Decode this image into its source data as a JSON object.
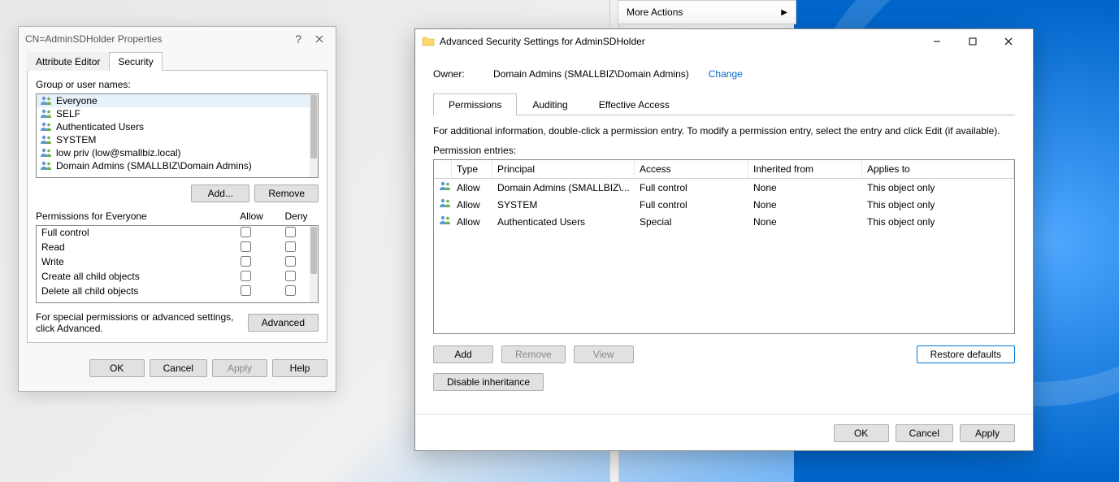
{
  "bgMenu": {
    "moreActions": "More Actions"
  },
  "win1": {
    "title": "CN=AdminSDHolder Properties",
    "tabs": [
      "Attribute Editor",
      "Security"
    ],
    "activeTab": 1,
    "groupLabel": "Group or user names:",
    "principals": [
      "Everyone",
      "SELF",
      "Authenticated Users",
      "SYSTEM",
      "low priv (low@smallbiz.local)",
      "Domain Admins (SMALLBIZ\\Domain Admins)"
    ],
    "addBtn": "Add...",
    "removeBtn": "Remove",
    "permForLabel": "Permissions for Everyone",
    "allowHdr": "Allow",
    "denyHdr": "Deny",
    "permissions": [
      "Full control",
      "Read",
      "Write",
      "Create all child objects",
      "Delete all child objects"
    ],
    "advText": "For special permissions or advanced settings, click Advanced.",
    "advBtn": "Advanced",
    "okBtn": "OK",
    "cancelBtn": "Cancel",
    "applyBtn": "Apply",
    "helpBtn": "Help"
  },
  "win2": {
    "title": "Advanced Security Settings for AdminSDHolder",
    "ownerLabel": "Owner:",
    "ownerValue": "Domain Admins (SMALLBIZ\\Domain Admins)",
    "changeLink": "Change",
    "tabs": [
      "Permissions",
      "Auditing",
      "Effective Access"
    ],
    "activeTab": 0,
    "infoText": "For additional information, double-click a permission entry. To modify a permission entry, select the entry and click Edit (if available).",
    "entriesLabel": "Permission entries:",
    "headers": {
      "type": "Type",
      "principal": "Principal",
      "access": "Access",
      "inherited": "Inherited from",
      "applies": "Applies to"
    },
    "entries": [
      {
        "type": "Allow",
        "principal": "Domain Admins (SMALLBIZ\\...",
        "access": "Full control",
        "inherited": "None",
        "applies": "This object only"
      },
      {
        "type": "Allow",
        "principal": "SYSTEM",
        "access": "Full control",
        "inherited": "None",
        "applies": "This object only"
      },
      {
        "type": "Allow",
        "principal": "Authenticated Users",
        "access": "Special",
        "inherited": "None",
        "applies": "This object only"
      }
    ],
    "addBtn": "Add",
    "removeBtn": "Remove",
    "viewBtn": "View",
    "restoreBtn": "Restore defaults",
    "disableBtn": "Disable inheritance",
    "okBtn": "OK",
    "cancelBtn": "Cancel",
    "applyBtn": "Apply"
  }
}
